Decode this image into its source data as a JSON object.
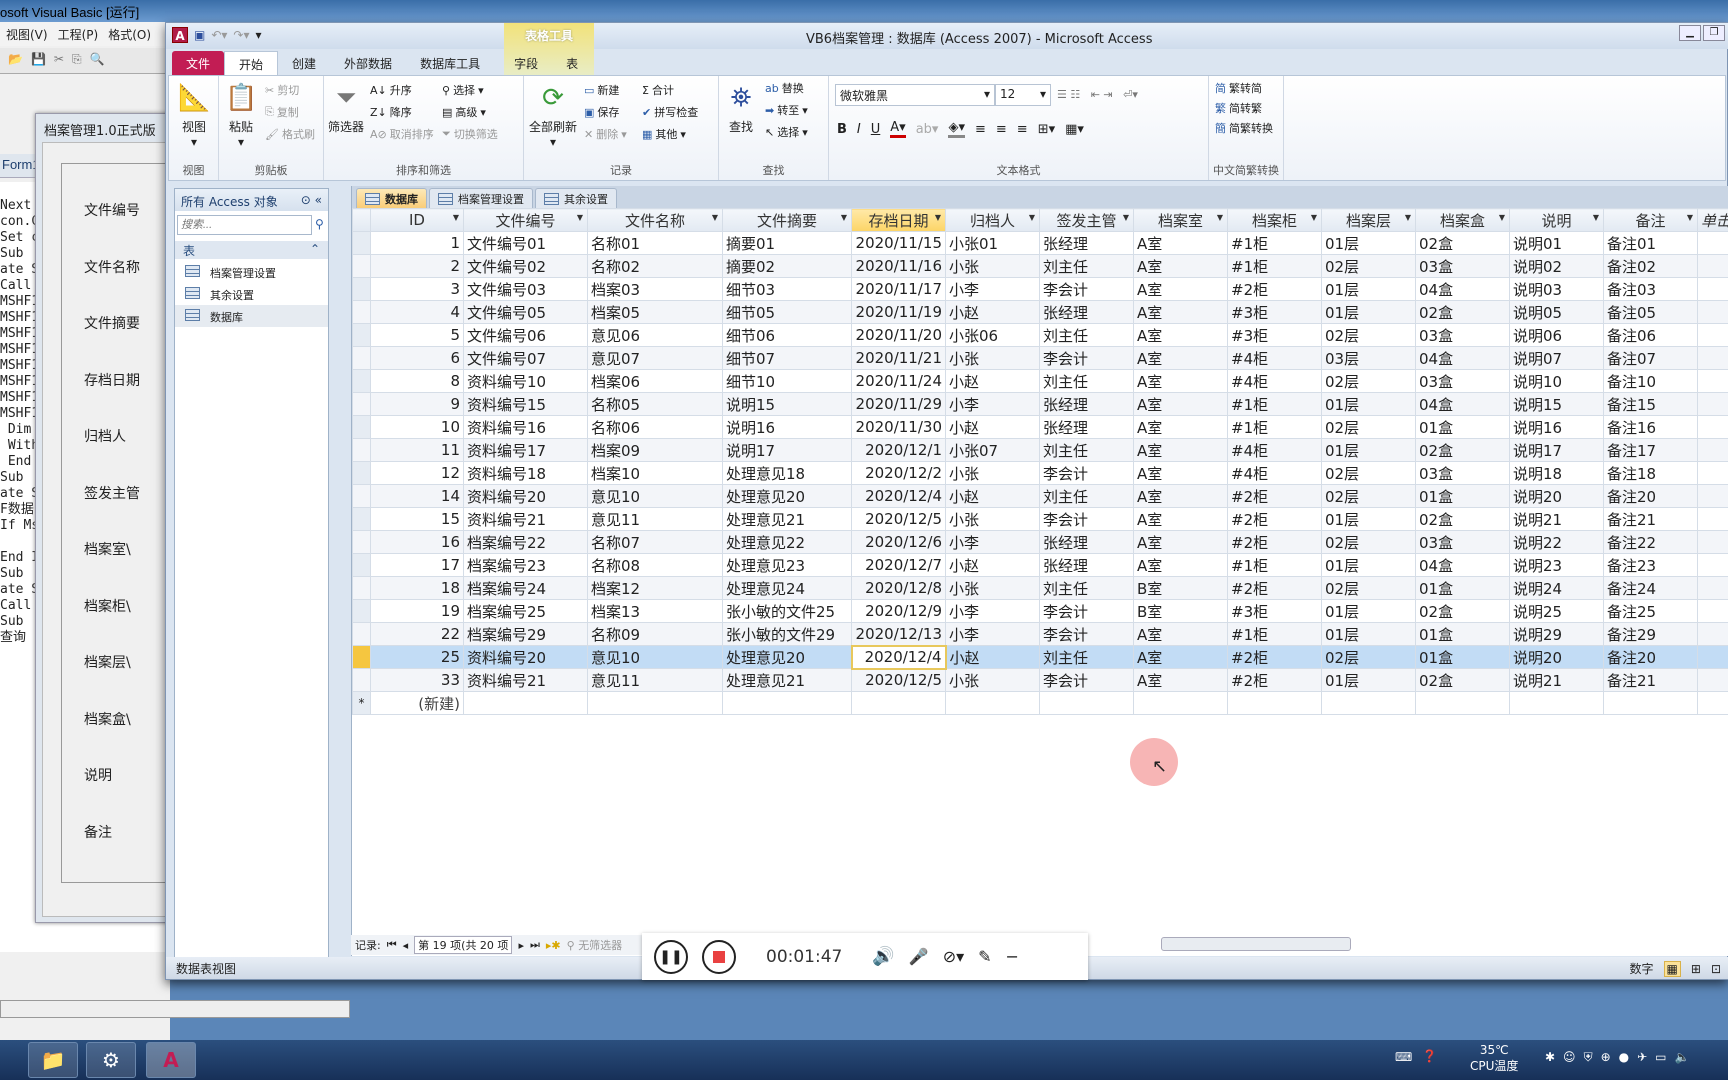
{
  "vb": {
    "title": "osoft Visual Basic [运行]",
    "menu": [
      "视图(V)",
      "工程(P)",
      "格式(O)"
    ],
    "code": [
      "         r",
      "Next",
      "",
      "con.C",
      "Set c",
      "Sub",
      "",
      "ate S",
      "Call",
      "",
      "MSHF1",
      "",
      "MSHF1",
      "MSHF1",
      "",
      "MSHF1",
      "MSHF1",
      "MSHF1",
      "MSHF1",
      "",
      "MSHF1",
      "",
      "",
      " Dim",
      " With",
      "",
      "",
      "",
      "",
      "",
      "",
      "",
      "",
      "",
      "",
      "",
      " End",
      "",
      "Sub",
      "ate S",
      "F数据",
      "If Ms",
      "     C",
      "End I",
      "Sub",
      "",
      "ate S",
      "Call",
      "Sub",
      "查询"
    ],
    "form_title": "档案管理1.0正式版",
    "form_tab": "Form1",
    "form_labels": [
      "文件编号",
      "文件名称",
      "文件摘要",
      "存档日期",
      "归档人",
      "签发主管",
      "档案室\\",
      "档案柜\\",
      "档案层\\",
      "档案盒\\",
      "说明",
      "备注"
    ]
  },
  "access": {
    "title": "VB6档案管理 : 数据库 (Access 2007)  -  Microsoft Access",
    "contextual_tab": "表格工具",
    "tabs": [
      "文件",
      "开始",
      "创建",
      "外部数据",
      "数据库工具",
      "字段",
      "表"
    ],
    "ribbon": {
      "view": {
        "btn": "视图",
        "group": "视图"
      },
      "clipboard": {
        "paste": "粘贴",
        "cut": "剪切",
        "copy": "复制",
        "format": "格式刷",
        "group": "剪贴板"
      },
      "sort": {
        "filter": "筛选器",
        "asc": "升序",
        "desc": "降序",
        "clear": "取消排序",
        "select": "选择",
        "advanced": "高级",
        "toggle": "切换筛选",
        "group": "排序和筛选"
      },
      "records": {
        "refresh": "全部刷新",
        "new": "新建",
        "save": "保存",
        "delete": "删除",
        "total": "合计",
        "spell": "拼写检查",
        "more": "其他",
        "group": "记录"
      },
      "find": {
        "find": "查找",
        "replace": "替换",
        "goto": "转至",
        "select": "选择",
        "group": "查找"
      },
      "text": {
        "font": "微软雅黑",
        "size": "12",
        "group": "文本格式"
      },
      "chinese": {
        "t2s": "繁转简",
        "s2t": "简转繁",
        "conv": "简繁转换",
        "group": "中文简繁转换"
      }
    },
    "nav": {
      "header": "所有 Access 对象",
      "search_placeholder": "搜索...",
      "section": "表",
      "items": [
        "档案管理设置",
        "其余设置",
        "数据库"
      ]
    },
    "doc_tabs": [
      "数据库",
      "档案管理设置",
      "其余设置"
    ],
    "columns": [
      "ID",
      "文件编号",
      "文件名称",
      "文件摘要",
      "存档日期",
      "归档人",
      "签发主管",
      "档案室",
      "档案柜",
      "档案层",
      "档案盒",
      "说明",
      "备注",
      "单击以添加"
    ],
    "rows": [
      [
        "1",
        "文件编号01",
        "名称01",
        "摘要01",
        "2020/11/15",
        "小张01",
        "张经理",
        "A室",
        "#1柜",
        "01层",
        "02盒",
        "说明01",
        "备注01"
      ],
      [
        "2",
        "文件编号02",
        "名称02",
        "摘要02",
        "2020/11/16",
        "小张",
        "刘主任",
        "A室",
        "#1柜",
        "02层",
        "03盒",
        "说明02",
        "备注02"
      ],
      [
        "3",
        "文件编号03",
        "档案03",
        "细节03",
        "2020/11/17",
        "小李",
        "李会计",
        "A室",
        "#2柜",
        "01层",
        "04盒",
        "说明03",
        "备注03"
      ],
      [
        "4",
        "文件编号05",
        "档案05",
        "细节05",
        "2020/11/19",
        "小赵",
        "张经理",
        "A室",
        "#3柜",
        "01层",
        "02盒",
        "说明05",
        "备注05"
      ],
      [
        "5",
        "文件编号06",
        "意见06",
        "细节06",
        "2020/11/20",
        "小张06",
        "刘主任",
        "A室",
        "#3柜",
        "02层",
        "03盒",
        "说明06",
        "备注06"
      ],
      [
        "6",
        "文件编号07",
        "意见07",
        "细节07",
        "2020/11/21",
        "小张",
        "李会计",
        "A室",
        "#4柜",
        "03层",
        "04盒",
        "说明07",
        "备注07"
      ],
      [
        "8",
        "资料编号10",
        "档案06",
        "细节10",
        "2020/11/24",
        "小赵",
        "刘主任",
        "A室",
        "#4柜",
        "02层",
        "03盒",
        "说明10",
        "备注10"
      ],
      [
        "9",
        "资料编号15",
        "名称05",
        "说明15",
        "2020/11/29",
        "小李",
        "张经理",
        "A室",
        "#1柜",
        "01层",
        "04盒",
        "说明15",
        "备注15"
      ],
      [
        "10",
        "资料编号16",
        "名称06",
        "说明16",
        "2020/11/30",
        "小赵",
        "张经理",
        "A室",
        "#1柜",
        "02层",
        "01盒",
        "说明16",
        "备注16"
      ],
      [
        "11",
        "资料编号17",
        "档案09",
        "说明17",
        "2020/12/1",
        "小张07",
        "刘主任",
        "A室",
        "#4柜",
        "01层",
        "02盒",
        "说明17",
        "备注17"
      ],
      [
        "12",
        "资料编号18",
        "档案10",
        "处理意见18",
        "2020/12/2",
        "小张",
        "李会计",
        "A室",
        "#4柜",
        "02层",
        "03盒",
        "说明18",
        "备注18"
      ],
      [
        "14",
        "资料编号20",
        "意见10",
        "处理意见20",
        "2020/12/4",
        "小赵",
        "刘主任",
        "A室",
        "#2柜",
        "02层",
        "01盒",
        "说明20",
        "备注20"
      ],
      [
        "15",
        "资料编号21",
        "意见11",
        "处理意见21",
        "2020/12/5",
        "小张",
        "李会计",
        "A室",
        "#2柜",
        "01层",
        "02盒",
        "说明21",
        "备注21"
      ],
      [
        "16",
        "档案编号22",
        "名称07",
        "处理意见22",
        "2020/12/6",
        "小李",
        "张经理",
        "A室",
        "#2柜",
        "02层",
        "03盒",
        "说明22",
        "备注22"
      ],
      [
        "17",
        "档案编号23",
        "名称08",
        "处理意见23",
        "2020/12/7",
        "小赵",
        "张经理",
        "A室",
        "#1柜",
        "01层",
        "04盒",
        "说明23",
        "备注23"
      ],
      [
        "18",
        "档案编号24",
        "档案12",
        "处理意见24",
        "2020/12/8",
        "小张",
        "刘主任",
        "B室",
        "#2柜",
        "02层",
        "01盒",
        "说明24",
        "备注24"
      ],
      [
        "19",
        "档案编号25",
        "档案13",
        "张小敏的文件25",
        "2020/12/9",
        "小李",
        "李会计",
        "B室",
        "#3柜",
        "01层",
        "02盒",
        "说明25",
        "备注25"
      ],
      [
        "22",
        "档案编号29",
        "名称09",
        "张小敏的文件29",
        "2020/12/13",
        "小李",
        "李会计",
        "A室",
        "#1柜",
        "01层",
        "01盒",
        "说明29",
        "备注29"
      ],
      [
        "25",
        "资料编号20",
        "意见10",
        "处理意见20",
        "2020/12/4",
        "小赵",
        "刘主任",
        "A室",
        "#2柜",
        "02层",
        "01盒",
        "说明20",
        "备注20"
      ],
      [
        "33",
        "资料编号21",
        "意见11",
        "处理意见21",
        "2020/12/5",
        "小张",
        "李会计",
        "A室",
        "#2柜",
        "01层",
        "02盒",
        "说明21",
        "备注21"
      ]
    ],
    "current_row_index": 18,
    "new_row_label": "(新建)",
    "record_nav": {
      "label": "记录:",
      "position": "第 19 项(共 20 项",
      "filter": "无筛选器"
    },
    "status": {
      "left": "数据表视图",
      "right": "数字"
    }
  },
  "recorder": {
    "time": "00:01:47"
  },
  "taskbar": {
    "cpu_temp": "35℃",
    "cpu_label": "CPU温度"
  }
}
